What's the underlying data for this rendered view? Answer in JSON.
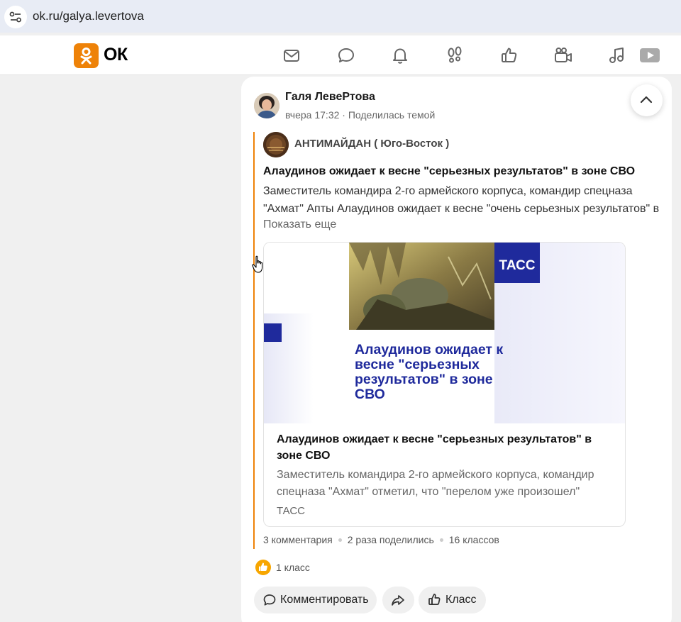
{
  "browser": {
    "url": "ok.ru/galya.levertova"
  },
  "header": {
    "logo_text": "ОК",
    "nav_icons": [
      "mail-icon",
      "chat-icon",
      "bell-icon",
      "footprints-icon",
      "thumbs-up-icon",
      "video-camera-icon",
      "music-icon",
      "video-play-icon"
    ]
  },
  "post": {
    "author": "Галя ЛевеРтова",
    "meta": "вчера 17:32 · Поделилась темой",
    "group_name": "АНТИМАЙДАН ( Юго-Восток )",
    "title": "Алаудинов ожидает к весне \"серьезных результатов\" в зоне СВО",
    "text": "Заместитель командира 2-го армейского корпуса, командир спецназа \"Ахмат\" Апты Алаудинов ожидает к весне \"очень серьезных результатов\" в",
    "show_more": "Показать еще",
    "link": {
      "image_badge": "ТАСС",
      "image_headline": "Алаудинов ожидает к весне \"серьезных результатов\" в зоне СВО",
      "title": "Алаудинов ожидает к весне \"серьезных результатов\" в зоне СВО",
      "description": "Заместитель командира 2-го армейского корпуса, командир спецназа \"Ахмат\" отметил, что \"перелом уже произошел\"",
      "source": "ТАСС"
    },
    "stats": {
      "comments": "3 комментария",
      "shares": "2 раза поделились",
      "classes": "16 классов"
    },
    "likes": "1 класс",
    "actions": {
      "comment": "Комментировать",
      "share": "",
      "like": "Класс"
    }
  },
  "colors": {
    "brand": "#ee8208",
    "tass_blue": "#1f2a9c",
    "like_yellow": "#f7a600"
  }
}
